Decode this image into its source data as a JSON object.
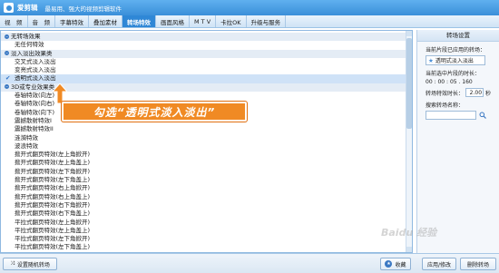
{
  "window": {
    "app_name": "爱剪辑",
    "slogan": "最易用、强大的视频剪辑软件"
  },
  "menu": {
    "tabs": [
      "视　频",
      "音　频",
      "字幕特效",
      "叠加素材",
      "转场特效",
      "画面风格",
      "M T V",
      "卡拉OK",
      "升级与服务"
    ],
    "active_index": 4
  },
  "list": {
    "rows": [
      {
        "type": "cat",
        "label": "无转场效果"
      },
      {
        "type": "item",
        "label": "无任何特效"
      },
      {
        "type": "cat",
        "label": "淡入淡出效果类"
      },
      {
        "type": "item",
        "label": "交叉式淡入淡出"
      },
      {
        "type": "item",
        "label": "变亮式淡入淡出"
      },
      {
        "type": "item",
        "label": "透明式淡入淡出",
        "selected": true
      },
      {
        "type": "cat",
        "label": "3D或专业效果类"
      },
      {
        "type": "item",
        "label": "卷轴特效(向左)"
      },
      {
        "type": "item",
        "label": "卷轴特效(向右)"
      },
      {
        "type": "item",
        "label": "卷轴特效(向下)"
      },
      {
        "type": "item",
        "label": "震撼散射特效I"
      },
      {
        "type": "item",
        "label": "震撼散射特效II"
      },
      {
        "type": "item",
        "label": "涟漪特效"
      },
      {
        "type": "item",
        "label": "波浪特效"
      },
      {
        "type": "item",
        "label": "掀开式翻页特效(左上角掀开)"
      },
      {
        "type": "item",
        "label": "掀开式翻页特效(左上角盖上)"
      },
      {
        "type": "item",
        "label": "掀开式翻页特效(左下角掀开)"
      },
      {
        "type": "item",
        "label": "掀开式翻页特效(左下角盖上)"
      },
      {
        "type": "item",
        "label": "掀开式翻页特效(右上角掀开)"
      },
      {
        "type": "item",
        "label": "掀开式翻页特效(右上角盖上)"
      },
      {
        "type": "item",
        "label": "掀开式翻页特效(右下角掀开)"
      },
      {
        "type": "item",
        "label": "掀开式翻页特效(右下角盖上)"
      },
      {
        "type": "item",
        "label": "平拉式翻页特效(左上角掀开)"
      },
      {
        "type": "item",
        "label": "平拉式翻页特效(左上角盖上)"
      },
      {
        "type": "item",
        "label": "平拉式翻页特效(左下角掀开)"
      },
      {
        "type": "item",
        "label": "平拉式翻页特效(左下角盖上)"
      }
    ]
  },
  "annotation": {
    "text": "勾选“透明式淡入淡出”"
  },
  "settings": {
    "header": "转场设置",
    "applied_label": "当前片段已应用的转场：",
    "applied_value": "透明式淡入淡出",
    "clip_duration_label": "当前选中片段的时长：",
    "clip_duration_value": "00 : 00 : 05 . 160",
    "transition_duration_label": "转场特效时长：",
    "transition_duration_value": "2.00",
    "transition_duration_unit": "秒",
    "search_label": "搜索转场名称："
  },
  "bottom": {
    "random_button": "设置随机转场",
    "collect_button": "收藏",
    "apply_button": "应用/修改",
    "delete_button": "删除转场"
  },
  "watermark": "Baidu 经验",
  "colors": {
    "titlebar": "#3a8fd9",
    "active_tab": "#2f87d6",
    "annotation": "#f08a24",
    "selected_row": "#cfe2f7"
  }
}
